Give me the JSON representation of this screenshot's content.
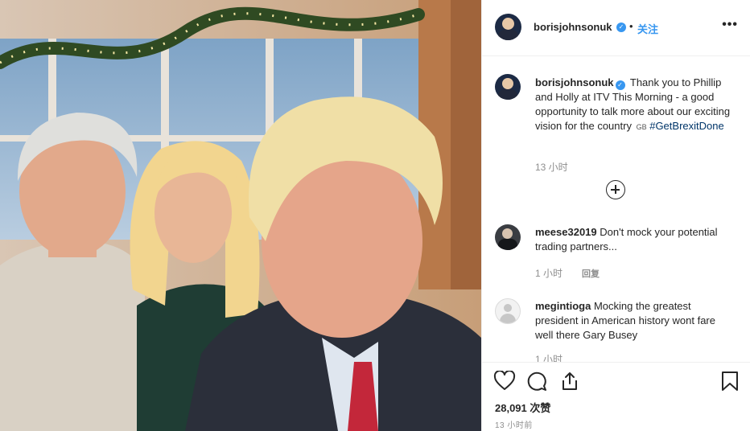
{
  "post": {
    "username": "borisjohnsonuk",
    "verified_icon": "verified-badge-icon",
    "separator": "•",
    "follow_label": "关注",
    "more_icon": "more-options-icon",
    "more_glyph": "•••"
  },
  "caption": {
    "username": "borisjohnsonuk",
    "text": "Thank you to Phillip and Holly at ITV This Morning - a good opportunity to talk more about our exciting vision for the country",
    "flag": "GB",
    "hashtag": "#GetBrexitDone",
    "time": "13 小时"
  },
  "load_more_icon": "plus-circle-icon",
  "comments": [
    {
      "username": "meese32019",
      "text": "Don't mock your potential trading partners...",
      "time": "1 小时",
      "reply_label": "回复"
    },
    {
      "username": "megintioga",
      "text": "Mocking the greatest president in American history wont fare well there Gary Busey",
      "time": "1 小时"
    }
  ],
  "actions": {
    "icons": [
      "heart-icon",
      "comment-icon",
      "share-icon",
      "bookmark-icon"
    ],
    "likes": "28,091 次赞",
    "posted": "13 小时前"
  },
  "colors": {
    "link": "#3897f0",
    "hashtag": "#003569",
    "muted": "#8e8e8e",
    "text": "#262626"
  }
}
